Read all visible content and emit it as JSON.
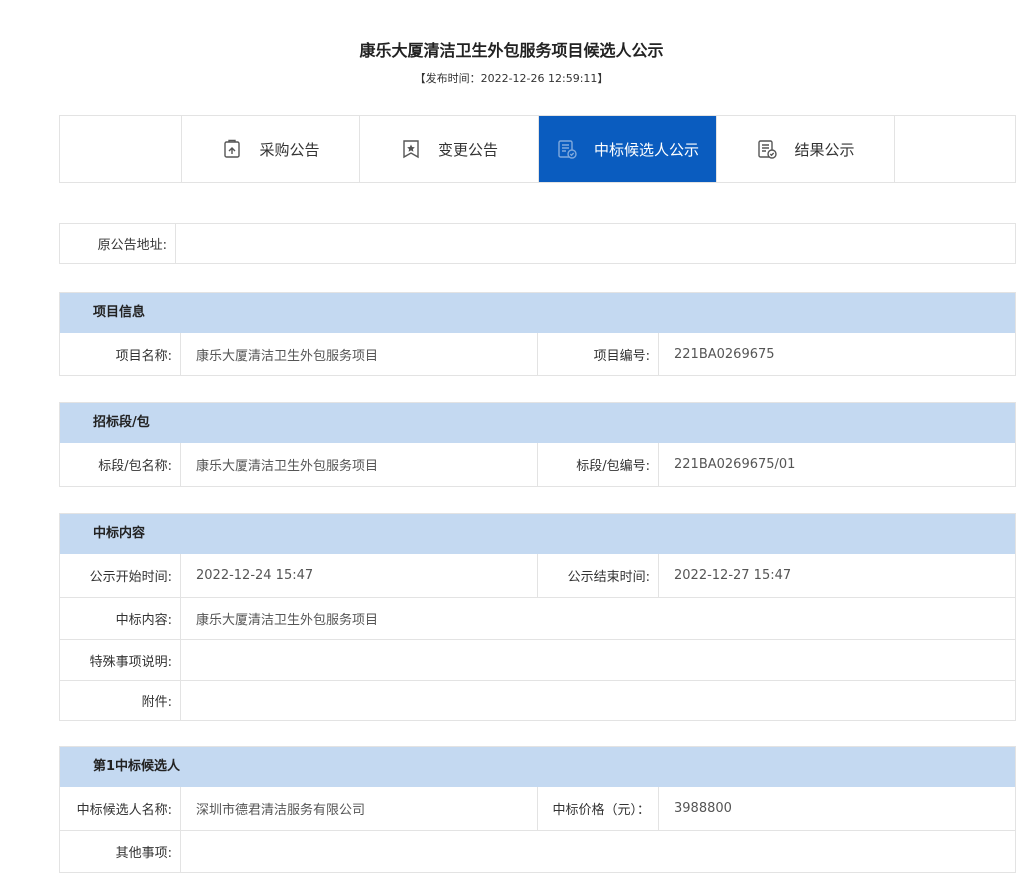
{
  "header": {
    "title": "康乐大厦清洁卫生外包服务项目候选人公示",
    "publish_time": "【发布时间：2022-12-26 12:59:11】"
  },
  "tabs": [
    {
      "label": "采购公告",
      "icon": "document-upload-icon",
      "active": false
    },
    {
      "label": "变更公告",
      "icon": "bookmark-star-icon",
      "active": false
    },
    {
      "label": "中标候选人公示",
      "icon": "document-check-icon",
      "active": true
    },
    {
      "label": "结果公示",
      "icon": "document-check-icon",
      "active": false
    }
  ],
  "original": {
    "label": "原公告地址:",
    "value": ""
  },
  "project": {
    "heading": "项目信息",
    "name_label": "项目名称:",
    "name": "康乐大厦清洁卫生外包服务项目",
    "code_label": "项目编号:",
    "code": "221BA0269675"
  },
  "section": {
    "heading": "招标段/包",
    "name_label": "标段/包名称:",
    "name": "康乐大厦清洁卫生外包服务项目",
    "code_label": "标段/包编号:",
    "code": "221BA0269675/01"
  },
  "award": {
    "heading": "中标内容",
    "start_label": "公示开始时间:",
    "start": "2022-12-24 15:47",
    "end_label": "公示结束时间:",
    "end": "2022-12-27 15:47",
    "content_label": "中标内容:",
    "content": "康乐大厦清洁卫生外包服务项目",
    "special_label": "特殊事项说明:",
    "special": "",
    "attach_label": "附件:",
    "attach": ""
  },
  "candidate": {
    "heading": "第1中标候选人",
    "name_label": "中标候选人名称:",
    "name": "深圳市德君清洁服务有限公司",
    "price_label": "中标价格（元）：",
    "price": "3988800",
    "other_label": "其他事项:",
    "other": ""
  },
  "colors": {
    "accent": "#0a5cbf",
    "section_bg": "#c4d9f1",
    "border": "#e3e3e3"
  }
}
